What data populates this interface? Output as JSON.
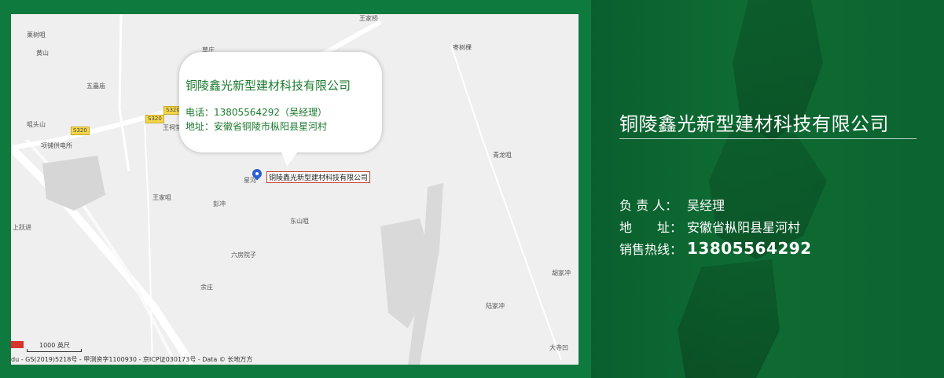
{
  "map": {
    "labels": [
      {
        "text": "王家桥"
      },
      {
        "text": "栗树咀"
      },
      {
        "text": "草庄"
      },
      {
        "text": "枣树棵"
      },
      {
        "text": "黄山"
      },
      {
        "text": "五畾庙"
      },
      {
        "text": "咀头山"
      },
      {
        "text": "王祠堂"
      },
      {
        "text": "青龙咀"
      },
      {
        "text": "王家咀"
      },
      {
        "text": "彭冲"
      },
      {
        "text": "星河"
      },
      {
        "text": "东山咀"
      },
      {
        "text": "上跃进"
      },
      {
        "text": "六房院子"
      },
      {
        "text": "余庄"
      },
      {
        "text": "胡家冲"
      },
      {
        "text": "陆家冲"
      },
      {
        "text": "大寺凹"
      },
      {
        "text": "项铺供电所"
      }
    ],
    "road_shields": [
      "S320",
      "S320",
      "S320"
    ],
    "bubble": {
      "title": "铜陵鑫光新型建材科技有限公司",
      "phone": "电话：13805564292（吴经理）",
      "address": "地址：安徽省铜陵市枞阳县星河村"
    },
    "marker_label": "铜陵鑫光新型建材科技有限公司",
    "scale": "1000 英尺",
    "copyright": "du - GS(2019)5218号 - 甲测资字1100930 - 京ICP证030173号 - Data © 长地万方"
  },
  "info": {
    "company": "铜陵鑫光新型建材科技有限公司",
    "contact_label": "负 责 人：",
    "contact_value": "吴经理",
    "address_label": "地　　址：",
    "address_value": "安徽省枞阳县星河村",
    "hotline_label": "销售热线：",
    "hotline_value": "13805564292"
  },
  "colors": {
    "frame_green": "#0e7a3e",
    "text_green": "#1c7a2f",
    "marker_blue": "#2d5fd1",
    "road_yellow": "#f5d84a"
  }
}
